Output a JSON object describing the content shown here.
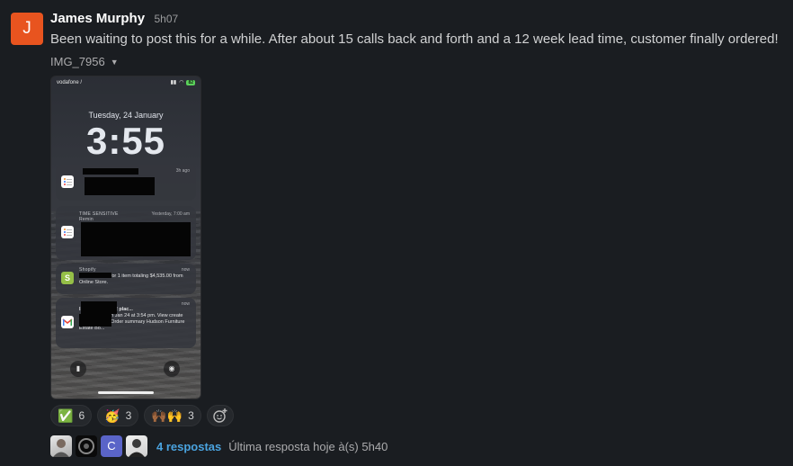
{
  "message": {
    "avatar_letter": "J",
    "avatar_color": "#e8541f",
    "author": "James Murphy",
    "time": "5h07",
    "text": "Been waiting to post this for a while. After about 15 calls back and forth and a 12 week lead time, customer finally ordered!",
    "file_name": "IMG_7956"
  },
  "phone": {
    "carrier": "vodafone /",
    "battery": "82",
    "date": "Tuesday, 24 January",
    "time": "3:55",
    "notifications": [
      {
        "app": "",
        "time": "3h ago",
        "text": ""
      },
      {
        "app": "TIME SENSITIVE",
        "sub": "Remin",
        "time": "Yesterday, 7:00 am",
        "text": ""
      },
      {
        "app": "Shopify",
        "time": "now",
        "text": "s a new order for 1 item totaling $4,535.00 from Online Store."
      },
      {
        "app": "",
        "time": "now",
        "line1": "l Order #AH1002 plac...",
        "text": "placed order on Jan 24 at 3:54 pm. View create shipping label Order summary Hudson Furniture Estate Bo..."
      }
    ]
  },
  "reactions": [
    {
      "emoji": "✅",
      "count": "6"
    },
    {
      "emoji": "🥳",
      "count": "3"
    },
    {
      "emoji": "🙌🏾🙌",
      "count": "3"
    }
  ],
  "thread": {
    "avatar3_letter": "C",
    "replies": "4 respostas",
    "last_reply": "Última resposta hoje à(s) 5h40"
  },
  "icons": [
    "add-reaction-icon",
    "chevron-down-icon",
    "flashlight-icon",
    "camera-icon"
  ],
  "colors": {
    "background": "#1a1d21",
    "link": "#4aa3df"
  }
}
